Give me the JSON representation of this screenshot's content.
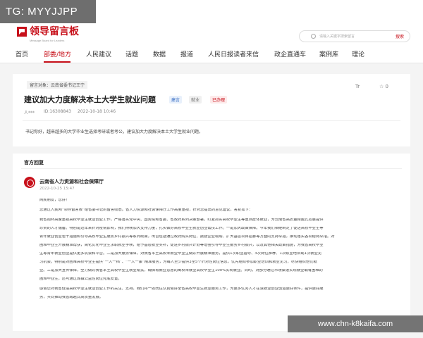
{
  "tag_label": "TG: MYYJJPP",
  "logo": {
    "name": "领导留言板",
    "sub": "Message Board for Leaders"
  },
  "search": {
    "placeholder": "请输入关键字搜索留言",
    "button": "搜索"
  },
  "nav": [
    "首页",
    "部委/地方",
    "人民建议",
    "话题",
    "数据",
    "报道",
    "人民日报读者来信",
    "政企直通车",
    "案例库",
    "理论"
  ],
  "message": {
    "target": "留言对象：云南省委书记王宁",
    "title": "建议加大力度解决本土大学生就业问题",
    "tags": [
      "建言",
      "就业",
      "已办理"
    ],
    "actions": [
      "Tr",
      "☆ 0"
    ],
    "author": "人***",
    "id": "ID:16308843",
    "date": "2022-10-18 10:46",
    "content": "书记你好，越来越多的大学毕业生选择考研或者考公，建议加大力度解决本土大学生就业问题。"
  },
  "reply": {
    "section_title": "官方回复",
    "org": "云南省人力资源和社会保障厅",
    "date": "2022-10-25 15:47",
    "paragraphs": [
      "网民朋友，您好！",
      "您通过人民网“领导留言板”给省委书记的留言收悉。省人力资源和社会保障厅工作高度重视，针对您提出的意见建议，答复如下：",
      "我省始终高度重视高校毕业生就业创业工作，严格落实党中央、国务院和省委、省政府系列决策部署，盯紧抓实高校毕业生等重点群体就业，为云南省高质量跨越式发展提供",
      "珍贵的人才储备。特别是近年来针对疫情影响，我们持续加大支持力度，扎实做好高校毕业生就业创业帮扶工作。一是加大政策保障。今年我们相继制定了促进高校毕业生等",
      "青年就业创业若干措施和引导高校毕业生服务乡村振兴等系列政策，出台包括通过政府购买岗位、鼓励企业吸纳、扩大基层项目招募等方面的支持举措，推动落实各项稳岗举措。对",
      "困难毕业生开展精准帮扶，简化优化毕业生求职就业手续，给予基层就业奖补，促进乡村振兴计划等增强引导毕业生服务乡村振兴，以及其他相关政策措施，为我省高校毕业",
      "生等青年就业创业提供更多机会和平台。二是加大服务保障，对我省本土高校未就业毕业生做好开展精准服务，提供1次职业指导、3次岗位推荐、1次职业培训或1次就业见",
      "习机会。特别是对困难高校毕业生提供“一人一档”、“一人一策”精准服务，为每人至少提供3至5个针对性岗位信息，优先组织参加职业培训和就业见习，尽快组织他们就",
      "业。三是加大宣传保障，全力做好我省本土高校毕业生就业帮扶，确保有就业意愿的离校未就业高校毕业生100%实现就业。同时，对部分通过市场渠道实现就业确有困难的",
      "困难毕业生，还可通过城镇公益性岗位兜底安置。",
      "感谢您对我省促进高校毕业生就业创业工作的关注、支持。我们将一如既往认真做好全省高校毕业生就业服务工作，为更多优秀人才在滇就业创业创造更好条件，提供更好服",
      "务，共同推动我省跨越式高质量发展。"
    ]
  },
  "watermark": "www.chn-k8kaifa.com",
  "colors": {
    "brand_red": "#c7101a"
  }
}
